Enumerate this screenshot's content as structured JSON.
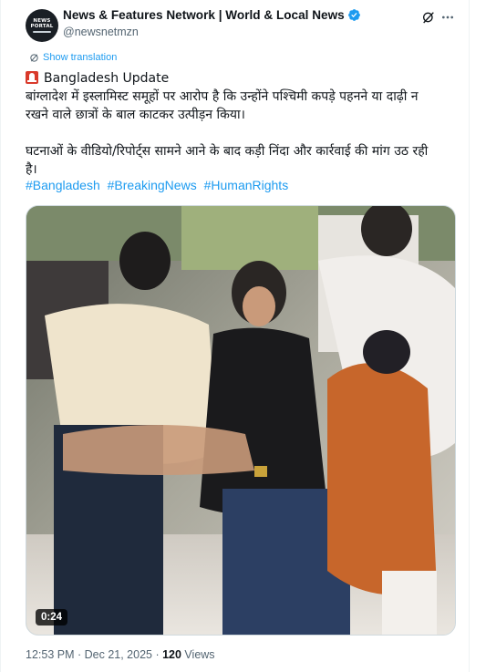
{
  "post": {
    "author": {
      "avatar_line1": "NEWS",
      "avatar_line2": "PORTAL",
      "display_name": "News & Features Network | World & Local News",
      "handle": "@newsnetmzn",
      "verified_color": "#1d9bf0"
    },
    "translate_label": "Show translation",
    "text_lines": [
      "Bangladesh Update",
      "बांग्लादेश में इस्लामिस्ट समूहों पर आरोप है कि उन्होंने पश्चिमी कपड़े पहनने या दाढ़ी न",
      "रखने वाले छात्रों के बाल काटकर उत्पीड़न किया।",
      "",
      "घटनाओं के वीडियो/रिपोर्ट्स सामने आने के बाद कड़ी निंदा और कार्रवाई की मांग उठ रही",
      "है।"
    ],
    "hashtags": [
      "#Bangladesh",
      "#BreakingNews",
      "#HumanRights"
    ],
    "video": {
      "duration": "0:24"
    },
    "timestamp": "12:53 PM · Dec 21, 2025 · ",
    "views_count": "120",
    "views_label": " Views"
  },
  "colors": {
    "accent": "#1d9bf0",
    "secondary_text": "#536471",
    "primary_text": "#0f1419"
  },
  "icons": {
    "grok": "grok-icon",
    "more": "more-icon",
    "translate": "translate-icon",
    "siren": "siren-emoji-icon",
    "verified": "verified-badge-icon"
  }
}
